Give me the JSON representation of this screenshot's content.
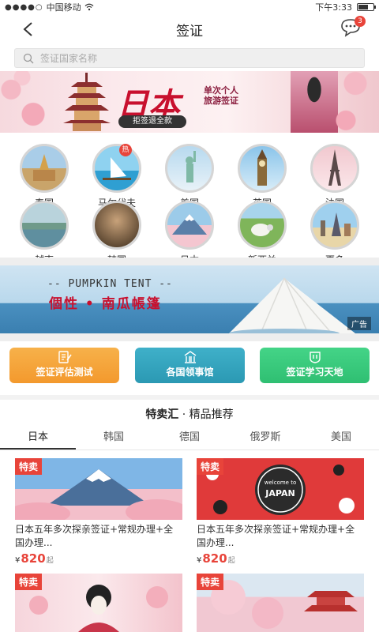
{
  "status": {
    "carrier": "中国移动",
    "time": "下午3:33",
    "signal_dots": "●●●●○"
  },
  "nav": {
    "title": "签证",
    "message_badge": "3"
  },
  "search": {
    "placeholder": "签证国家名称"
  },
  "banner_top": {
    "headline": "日本",
    "tagline_line1": "单次个人",
    "tagline_line2": "旅游签证",
    "pill": "拒签退全款"
  },
  "countries": [
    {
      "name": "泰国",
      "icon": "thailand-temple-icon"
    },
    {
      "name": "马尔代夫",
      "icon": "maldives-beach-icon",
      "badge": "热"
    },
    {
      "name": "美国",
      "icon": "statue-of-liberty-icon"
    },
    {
      "name": "英国",
      "icon": "big-ben-icon"
    },
    {
      "name": "法国",
      "icon": "eiffel-tower-icon"
    },
    {
      "name": "越南",
      "icon": "vietnam-bay-icon"
    },
    {
      "name": "韩国",
      "icon": "korea-palace-icon"
    },
    {
      "name": "日本",
      "icon": "mount-fuji-icon"
    },
    {
      "name": "新西兰",
      "icon": "sheep-meadow-icon"
    },
    {
      "name": "更多",
      "icon": "globe-landmarks-icon"
    }
  ],
  "banner_ad": {
    "title_en": "-- PUMPKIN TENT --",
    "title_cn": "個性 • 南瓜帳篷",
    "promo": "",
    "ad_label": "广告"
  },
  "quick_actions": [
    {
      "label": "签证评估测试",
      "color": "#f4a03a"
    },
    {
      "label": "各国领事馆",
      "color": "#33a4bf"
    },
    {
      "label": "签证学习天地",
      "color": "#3bcb7d"
    }
  ],
  "section": {
    "title_main": "特卖汇",
    "title_sep": " · ",
    "title_sub": "精品推荐"
  },
  "tabs": [
    "日本",
    "韩国",
    "德国",
    "俄罗斯",
    "美国"
  ],
  "products": [
    {
      "tag": "特卖",
      "title": "日本五年多次探亲签证+常规办理+全国办理...",
      "currency": "¥",
      "price": "820",
      "unit": "起"
    },
    {
      "tag": "特卖",
      "title": "日本五年多次探亲签证+常规办理+全国办理...",
      "currency": "¥",
      "price": "820",
      "unit": "起",
      "badge_text": "welcome to",
      "badge_main": "JAPAN"
    },
    {
      "tag": "特卖"
    },
    {
      "tag": "特卖"
    }
  ]
}
